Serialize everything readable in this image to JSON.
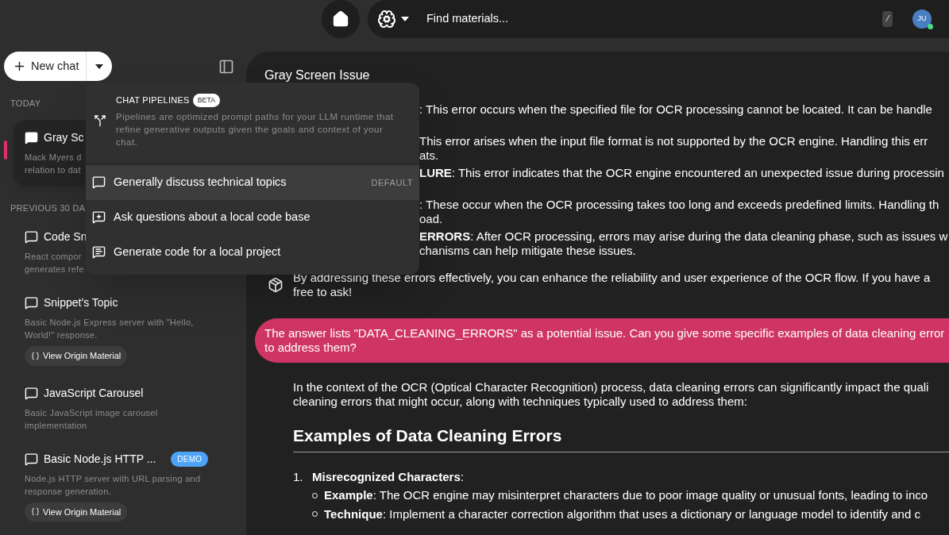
{
  "top_bar": {
    "search": {
      "placeholder": "Find materials..."
    },
    "shortcut": "/",
    "avatar": {
      "initials": "JU",
      "online": true
    }
  },
  "sidebar": {
    "new_chat": "New chat",
    "sections": [
      {
        "label": "TODAY",
        "chats": [
          {
            "title": "Gray Sc",
            "subtitle_lines": [
              "Mack Myers d",
              "relation to dat"
            ],
            "selected": true
          }
        ]
      },
      {
        "label": "PREVIOUS 30 DA",
        "chats": [
          {
            "title": "Code Sn",
            "subtitle_lines": [
              "React compor",
              "generates refe"
            ],
            "selected": false
          },
          {
            "title": "Snippet's Topic",
            "subtitle_lines": [
              "Basic Node.js Express server with \"Hello,",
              "World!\" response."
            ],
            "selected": false,
            "action": "View Origin Material"
          },
          {
            "title": "JavaScript Carousel",
            "subtitle_lines": [
              "Basic JavaScript image carousel",
              "implementation"
            ],
            "selected": false
          },
          {
            "title": "Basic Node.js HTTP ...",
            "badge": "DEMO",
            "subtitle_lines": [
              "Node.js HTTP server with URL parsing and",
              "response generation."
            ],
            "selected": false,
            "action": "View Origin Material"
          }
        ]
      }
    ]
  },
  "chat_panel": {
    "title": "Gray Screen Issue",
    "messages": [
      {
        "kind": "partial",
        "paragraphs": [
          [
            ": This error occurs when the specified file for OCR processing cannot be located. It can be handle"
          ],
          [
            "This error arises when the input file format is not supported by the OCR engine. Handling this err",
            "ats."
          ],
          [
            "**LURE**: This error indicates that the OCR engine encountered an unexpected issue during processin"
          ],
          [
            ": These occur when the OCR processing takes too long and exceeds predefined limits. Handling th",
            "oad."
          ],
          [
            "**ERRORS**: After OCR processing, errors may arise during the data cleaning phase, such as issues w",
            "chanisms can help mitigate these issues."
          ]
        ]
      },
      {
        "kind": "assistant",
        "avatar": true,
        "paragraphs": [
          [
            "By addressing these errors effectively, you can enhance the reliability and user experience of the OCR flow. If you have a",
            "free to ask!"
          ]
        ]
      },
      {
        "kind": "user",
        "paragraphs": [
          [
            "The answer lists \"DATA_CLEANING_ERRORS\" as a potential issue. Can you give some specific examples of data cleaning error",
            "to address them?"
          ]
        ]
      },
      {
        "kind": "assistant",
        "avatar": false,
        "paragraphs": [
          [
            "In the context of the OCR (Optical Character Recognition) process, data cleaning errors can significantly impact the quali",
            "cleaning errors that might occur, along with techniques typically used to address them:"
          ]
        ],
        "heading": "Examples of Data Cleaning Errors",
        "list": [
          {
            "number": "1.",
            "text": "**Misrecognized Characters**:",
            "bullets": [
              "**Example**: The OCR engine may misinterpret characters due to poor image quality or unusual fonts, leading to inco",
              "**Technique**: Implement a character correction algorithm that uses a dictionary or language model to identify and c"
            ]
          }
        ]
      }
    ]
  },
  "pipelines_menu": {
    "title": "CHAT PIPELINES",
    "badge": "BETA",
    "description": "Pipelines are optimized prompt paths for your LLM runtime that refine generative outputs given the goals and context of your chat.",
    "items": [
      {
        "kind": "discuss",
        "label": "Generally discuss technical topics",
        "tag": "DEFAULT",
        "selected": true
      },
      {
        "kind": "ask",
        "label": "Ask questions about a local code base",
        "selected": false
      },
      {
        "kind": "generate",
        "label": "Generate code for a local project",
        "selected": false
      }
    ]
  }
}
